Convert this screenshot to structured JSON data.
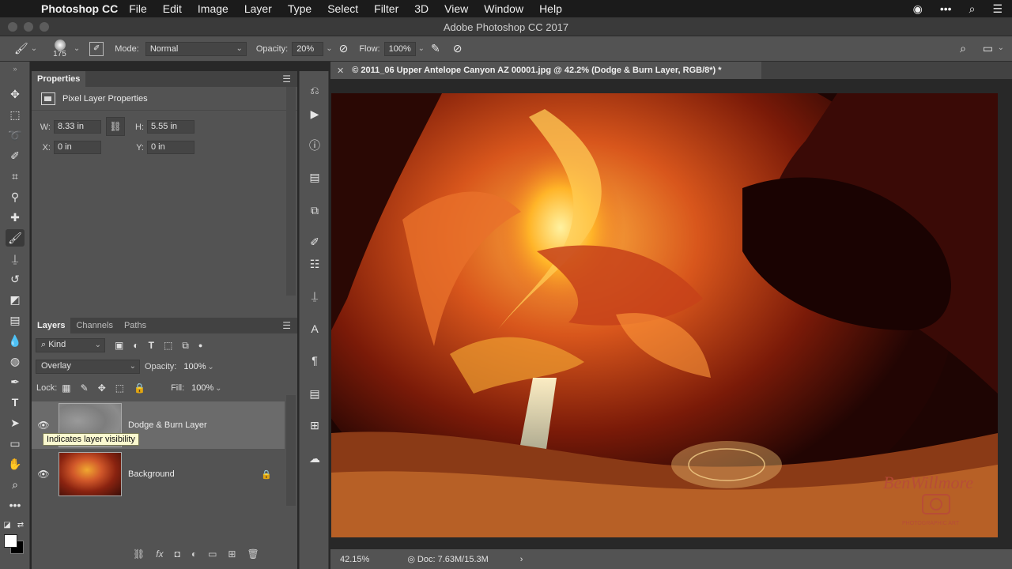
{
  "menubar": {
    "app_name": "Photoshop CC",
    "items": [
      "File",
      "Edit",
      "Image",
      "Layer",
      "Type",
      "Select",
      "Filter",
      "3D",
      "View",
      "Window",
      "Help"
    ]
  },
  "window": {
    "title": "Adobe Photoshop CC 2017"
  },
  "options_bar": {
    "brush_size": "175",
    "mode_label": "Mode:",
    "mode_value": "Normal",
    "opacity_label": "Opacity:",
    "opacity_value": "20%",
    "flow_label": "Flow:",
    "flow_value": "100%"
  },
  "properties_panel": {
    "tab": "Properties",
    "title": "Pixel Layer Properties",
    "w_label": "W:",
    "w_value": "8.33 in",
    "h_label": "H:",
    "h_value": "5.55 in",
    "x_label": "X:",
    "x_value": "0 in",
    "y_label": "Y:",
    "y_value": "0 in"
  },
  "layers_panel": {
    "tabs": [
      "Layers",
      "Channels",
      "Paths"
    ],
    "filter_value": "Kind",
    "blend_mode": "Overlay",
    "opacity_label": "Opacity:",
    "opacity_value": "100%",
    "lock_label": "Lock:",
    "fill_label": "Fill:",
    "fill_value": "100%",
    "layers": [
      {
        "name": "Dodge & Burn Layer",
        "selected": true
      },
      {
        "name": "Background",
        "locked": true
      }
    ],
    "tooltip": "Indicates layer visibility"
  },
  "document": {
    "tab_title": "© 2011_06 Upper Antelope Canyon AZ 00001.jpg @ 42.2% (Dodge & Burn Layer, RGB/8*) *",
    "watermark_name": "BenWillmore",
    "watermark_sub": "PHOTOGRAPHIC ART"
  },
  "status_bar": {
    "zoom": "42.15%",
    "doc_info": "Doc: 7.63M/15.3M"
  },
  "icons": {
    "apple": "apple-icon",
    "brush_tool": "brush-icon",
    "eye": "eye-icon",
    "lock": "lock-icon"
  }
}
